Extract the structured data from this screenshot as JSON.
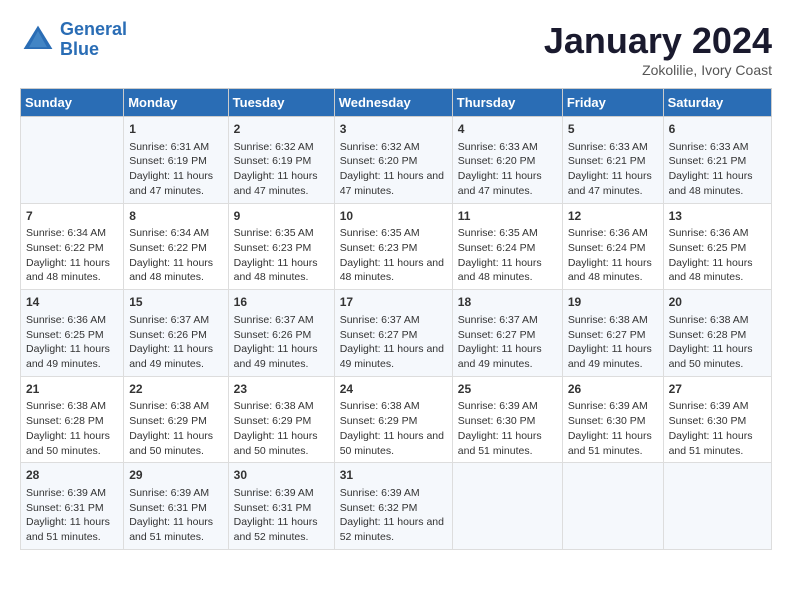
{
  "header": {
    "logo_line1": "General",
    "logo_line2": "Blue",
    "month": "January 2024",
    "location": "Zokolilie, Ivory Coast"
  },
  "days_of_week": [
    "Sunday",
    "Monday",
    "Tuesday",
    "Wednesday",
    "Thursday",
    "Friday",
    "Saturday"
  ],
  "weeks": [
    [
      {
        "day": "",
        "content": ""
      },
      {
        "day": "1",
        "content": "Sunrise: 6:31 AM\nSunset: 6:19 PM\nDaylight: 11 hours and 47 minutes."
      },
      {
        "day": "2",
        "content": "Sunrise: 6:32 AM\nSunset: 6:19 PM\nDaylight: 11 hours and 47 minutes."
      },
      {
        "day": "3",
        "content": "Sunrise: 6:32 AM\nSunset: 6:20 PM\nDaylight: 11 hours and 47 minutes."
      },
      {
        "day": "4",
        "content": "Sunrise: 6:33 AM\nSunset: 6:20 PM\nDaylight: 11 hours and 47 minutes."
      },
      {
        "day": "5",
        "content": "Sunrise: 6:33 AM\nSunset: 6:21 PM\nDaylight: 11 hours and 47 minutes."
      },
      {
        "day": "6",
        "content": "Sunrise: 6:33 AM\nSunset: 6:21 PM\nDaylight: 11 hours and 48 minutes."
      }
    ],
    [
      {
        "day": "7",
        "content": "Sunrise: 6:34 AM\nSunset: 6:22 PM\nDaylight: 11 hours and 48 minutes."
      },
      {
        "day": "8",
        "content": "Sunrise: 6:34 AM\nSunset: 6:22 PM\nDaylight: 11 hours and 48 minutes."
      },
      {
        "day": "9",
        "content": "Sunrise: 6:35 AM\nSunset: 6:23 PM\nDaylight: 11 hours and 48 minutes."
      },
      {
        "day": "10",
        "content": "Sunrise: 6:35 AM\nSunset: 6:23 PM\nDaylight: 11 hours and 48 minutes."
      },
      {
        "day": "11",
        "content": "Sunrise: 6:35 AM\nSunset: 6:24 PM\nDaylight: 11 hours and 48 minutes."
      },
      {
        "day": "12",
        "content": "Sunrise: 6:36 AM\nSunset: 6:24 PM\nDaylight: 11 hours and 48 minutes."
      },
      {
        "day": "13",
        "content": "Sunrise: 6:36 AM\nSunset: 6:25 PM\nDaylight: 11 hours and 48 minutes."
      }
    ],
    [
      {
        "day": "14",
        "content": "Sunrise: 6:36 AM\nSunset: 6:25 PM\nDaylight: 11 hours and 49 minutes."
      },
      {
        "day": "15",
        "content": "Sunrise: 6:37 AM\nSunset: 6:26 PM\nDaylight: 11 hours and 49 minutes."
      },
      {
        "day": "16",
        "content": "Sunrise: 6:37 AM\nSunset: 6:26 PM\nDaylight: 11 hours and 49 minutes."
      },
      {
        "day": "17",
        "content": "Sunrise: 6:37 AM\nSunset: 6:27 PM\nDaylight: 11 hours and 49 minutes."
      },
      {
        "day": "18",
        "content": "Sunrise: 6:37 AM\nSunset: 6:27 PM\nDaylight: 11 hours and 49 minutes."
      },
      {
        "day": "19",
        "content": "Sunrise: 6:38 AM\nSunset: 6:27 PM\nDaylight: 11 hours and 49 minutes."
      },
      {
        "day": "20",
        "content": "Sunrise: 6:38 AM\nSunset: 6:28 PM\nDaylight: 11 hours and 50 minutes."
      }
    ],
    [
      {
        "day": "21",
        "content": "Sunrise: 6:38 AM\nSunset: 6:28 PM\nDaylight: 11 hours and 50 minutes."
      },
      {
        "day": "22",
        "content": "Sunrise: 6:38 AM\nSunset: 6:29 PM\nDaylight: 11 hours and 50 minutes."
      },
      {
        "day": "23",
        "content": "Sunrise: 6:38 AM\nSunset: 6:29 PM\nDaylight: 11 hours and 50 minutes."
      },
      {
        "day": "24",
        "content": "Sunrise: 6:38 AM\nSunset: 6:29 PM\nDaylight: 11 hours and 50 minutes."
      },
      {
        "day": "25",
        "content": "Sunrise: 6:39 AM\nSunset: 6:30 PM\nDaylight: 11 hours and 51 minutes."
      },
      {
        "day": "26",
        "content": "Sunrise: 6:39 AM\nSunset: 6:30 PM\nDaylight: 11 hours and 51 minutes."
      },
      {
        "day": "27",
        "content": "Sunrise: 6:39 AM\nSunset: 6:30 PM\nDaylight: 11 hours and 51 minutes."
      }
    ],
    [
      {
        "day": "28",
        "content": "Sunrise: 6:39 AM\nSunset: 6:31 PM\nDaylight: 11 hours and 51 minutes."
      },
      {
        "day": "29",
        "content": "Sunrise: 6:39 AM\nSunset: 6:31 PM\nDaylight: 11 hours and 51 minutes."
      },
      {
        "day": "30",
        "content": "Sunrise: 6:39 AM\nSunset: 6:31 PM\nDaylight: 11 hours and 52 minutes."
      },
      {
        "day": "31",
        "content": "Sunrise: 6:39 AM\nSunset: 6:32 PM\nDaylight: 11 hours and 52 minutes."
      },
      {
        "day": "",
        "content": ""
      },
      {
        "day": "",
        "content": ""
      },
      {
        "day": "",
        "content": ""
      }
    ]
  ]
}
